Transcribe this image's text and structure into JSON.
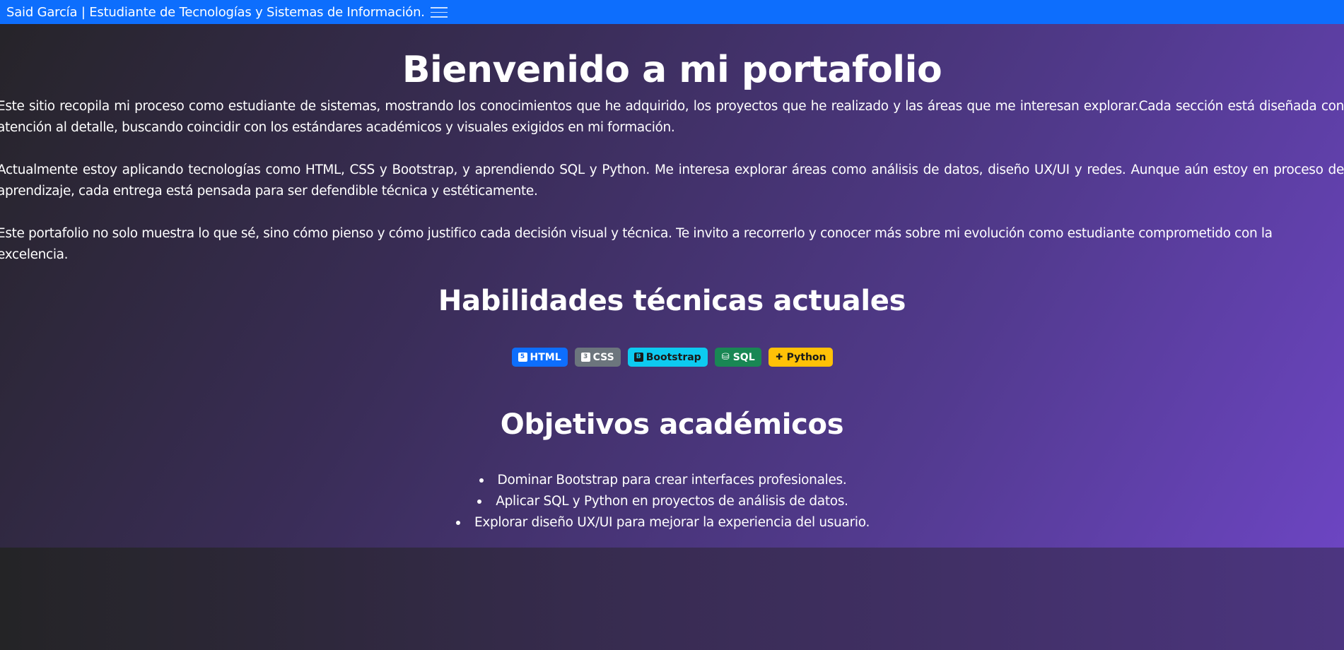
{
  "navbar": {
    "brand": "Said García | Estudiante de Tecnologías y Sistemas de Información.",
    "toggler_icon": "hamburger-menu-icon"
  },
  "hero": {
    "title": "Bienvenido a mi portafolio",
    "paragraphs": [
      "Este sitio recopila mi proceso como estudiante de sistemas, mostrando los conocimientos que he adquirido, los proyectos que he realizado y las áreas que me interesan explorar.Cada sección está diseñada con atención al detalle, buscando coincidir con los estándares académicos y visuales exigidos en mi formación.",
      "Actualmente estoy aplicando tecnologías como HTML, CSS y Bootstrap, y aprendiendo SQL y Python. Me interesa explorar áreas como análisis de datos, diseño UX/UI y redes. Aunque aún estoy en proceso de aprendizaje, cada entrega está pensada para ser defendible técnica y estéticamente.",
      "Este portafolio no solo muestra lo que sé, sino cómo pienso y cómo justifico cada decisión visual y técnica. Te invito a recorrerlo y conocer más sobre mi evolución como estudiante comprometido con la excelencia."
    ]
  },
  "skills": {
    "heading": "Habilidades técnicas actuales",
    "badges": [
      {
        "label": "HTML",
        "icon": "html5-icon",
        "color": "#0d6efd"
      },
      {
        "label": "CSS",
        "icon": "css3-icon",
        "color": "#6c757d"
      },
      {
        "label": "Bootstrap",
        "icon": "bootstrap-icon",
        "color": "#0dcaf0"
      },
      {
        "label": "SQL",
        "icon": "database-icon",
        "color": "#198754"
      },
      {
        "label": "Python",
        "icon": "python-icon",
        "color": "#ffc107"
      }
    ]
  },
  "goals": {
    "heading": "Objetivos académicos",
    "items": [
      "Dominar Bootstrap para crear interfaces profesionales.",
      "Aplicar SQL y Python en proyectos de análisis de datos.",
      "Explorar diseño UX/UI para mejorar la experiencia del usuario."
    ]
  },
  "colors": {
    "navbar": "#0d6efd",
    "gradient_start": "#262429",
    "gradient_end": "#6c45c2"
  }
}
